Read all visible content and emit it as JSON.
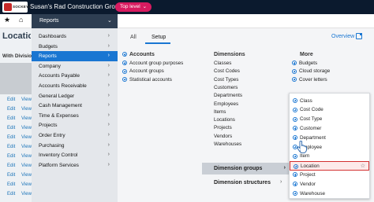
{
  "topbar": {
    "logo_text": "SOCKEYE",
    "company": "Susan's Rad Construction Group",
    "level_pill": "Top level",
    "pill_chevron": "⌄"
  },
  "navbar": {
    "star": "★",
    "home": "⌂",
    "reports_tab": "Reports",
    "reports_chevron": "⌄"
  },
  "page": {
    "title": "Locations",
    "subtitle": "With Divisions",
    "row_edit": "Edit",
    "row_view": "View"
  },
  "menu": {
    "items": [
      {
        "label": "Dashboards"
      },
      {
        "label": "Budgets"
      },
      {
        "label": "Reports"
      },
      {
        "label": "Company"
      },
      {
        "label": "Accounts Payable"
      },
      {
        "label": "Accounts Receivable"
      },
      {
        "label": "General Ledger"
      },
      {
        "label": "Cash Management"
      },
      {
        "label": "Time & Expenses"
      },
      {
        "label": "Projects"
      },
      {
        "label": "Order Entry"
      },
      {
        "label": "Purchasing"
      },
      {
        "label": "Inventory Control"
      },
      {
        "label": "Platform Services"
      }
    ],
    "arrow": "›"
  },
  "panel": {
    "tabs": [
      "All",
      "Setup"
    ],
    "overview": "Overview",
    "accounts": {
      "heading": "Accounts",
      "items": [
        "Account group purposes",
        "Account groups",
        "Statistical accounts"
      ]
    },
    "dimensions": {
      "heading": "Dimensions",
      "items": [
        "Classes",
        "Cost Codes",
        "Cost Types",
        "Customers",
        "Departments",
        "Employees",
        "Items",
        "Locations",
        "Projects",
        "Vendors",
        "Warehouses"
      ],
      "group_label": "Dimension groups",
      "structures_label": "Dimension structures",
      "gt": "›"
    },
    "more": {
      "heading": "More",
      "items": [
        "Budgets",
        "Cloud storage",
        "Cover letters"
      ]
    }
  },
  "submenu": {
    "items": [
      "Class",
      "Cost Code",
      "Cost Type",
      "Customer",
      "Department",
      "Employee",
      "Item",
      "Location",
      "Project",
      "Vendor",
      "Warehouse"
    ],
    "star": "☆"
  },
  "colors": {
    "topbar_bg": "#0b1a2e",
    "accent_blue": "#1976d2",
    "pill_pink": "#d81b60",
    "highlight_red": "#d32f2f"
  }
}
